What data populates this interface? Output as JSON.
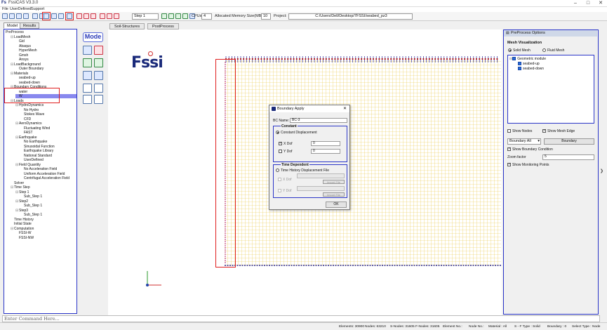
{
  "window": {
    "title": "FssiCAS V3.3.0"
  },
  "menu": [
    "File",
    "UserDefined",
    "Support"
  ],
  "toolbar": {
    "step_value": "Step 1",
    "cpus_label": "CPUs",
    "cpus_value": "4",
    "memory_label": "Allocated Memory Size(MB)",
    "memory_value": "10",
    "project_label": "Project:",
    "project_value": "C:/Users/Dell/Desktop/7FSSI/seabed_pz3"
  },
  "left_tabs": [
    "Model",
    "Results"
  ],
  "tree": [
    {
      "label": "PreProcess",
      "level": 0
    },
    {
      "label": "LoadMesh",
      "level": 1
    },
    {
      "label": "Gid",
      "level": 2
    },
    {
      "label": "Abaqus",
      "level": 2
    },
    {
      "label": "HyperMesh",
      "level": 2
    },
    {
      "label": "Gmsh",
      "level": 2
    },
    {
      "label": "Ansys",
      "level": 2
    },
    {
      "label": "LoadBackground",
      "level": 1
    },
    {
      "label": "Outer Boundary",
      "level": 2
    },
    {
      "label": "Materials",
      "level": 1
    },
    {
      "label": "seabed-up",
      "level": 2
    },
    {
      "label": "seabed-down",
      "level": 2
    },
    {
      "label": "Boundary Conditions",
      "level": 1
    },
    {
      "label": "water",
      "level": 2
    },
    {
      "label": "W",
      "level": 2
    },
    {
      "label": "Loads",
      "level": 1
    },
    {
      "label": "HydroDynamics",
      "level": 2
    },
    {
      "label": "No Hydro",
      "level": 3
    },
    {
      "label": "Stokes Wave",
      "level": 3
    },
    {
      "label": "CFD",
      "level": 3
    },
    {
      "label": "AeroDynamics",
      "level": 2
    },
    {
      "label": "Fluctuating Wind",
      "level": 3
    },
    {
      "label": "FAST",
      "level": 3
    },
    {
      "label": "Earthquake",
      "level": 2
    },
    {
      "label": "No Earthquake",
      "level": 3
    },
    {
      "label": "Sinusoidal Function",
      "level": 3
    },
    {
      "label": "Earthquake Library",
      "level": 3
    },
    {
      "label": "National Standard",
      "level": 3
    },
    {
      "label": "UserDefined",
      "level": 3
    },
    {
      "label": "Field Quantity",
      "level": 2
    },
    {
      "label": "No Acceleration Field",
      "level": 3
    },
    {
      "label": "Uniform Acceleration Field",
      "level": 3
    },
    {
      "label": "Centrifugal Acceleration Field",
      "level": 3
    },
    {
      "label": "Solver",
      "level": 1
    },
    {
      "label": "Time Step",
      "level": 1
    },
    {
      "label": "Step 1",
      "level": 2
    },
    {
      "label": "Sub_Step 1",
      "level": 3
    },
    {
      "label": "Step2",
      "level": 2
    },
    {
      "label": "Sub_Step 1",
      "level": 3
    },
    {
      "label": "Step3",
      "level": 2
    },
    {
      "label": "Sub_Step 1",
      "level": 3
    },
    {
      "label": "Time History",
      "level": 1
    },
    {
      "label": "Initial State",
      "level": 1
    },
    {
      "label": "Computation",
      "level": 1
    },
    {
      "label": "FSSI-W",
      "level": 2
    },
    {
      "label": "FSSI-NW",
      "level": 2
    }
  ],
  "center_tabs": [
    "Soil-Structures",
    "PostProcess"
  ],
  "logo_text": "Fssi",
  "dialog": {
    "title": "Boundary Apply",
    "bc_name_label": "BC Name:",
    "bc_name_value": "BC-3",
    "constant_group": "Constant",
    "constant_disp": "Constant Displacement",
    "x_dof": "X Dof",
    "x_dof_value": "0",
    "y_dof": "Y Dof",
    "y_dof_value": "0",
    "time_group": "Time Dependent",
    "time_history": "Time History Displacement File",
    "x_dof2": "X Dof",
    "y_dof2": "Y Dof",
    "import_file": "Import File",
    "ok": "OK"
  },
  "right_panel": {
    "header": "PreProcess Options",
    "mesh_vis": "Mesh Visualization",
    "solid_mesh": "Solid Mesh",
    "fluid_mesh": "Fluid Mesh",
    "geom_module": "Geometric module",
    "seabed_up": "seabed-up",
    "seabed_down": "seabed-down",
    "show_nodes": "Show Nodes",
    "show_mesh_edge": "Show Mesh Edge",
    "boundary_all": "Boundary All",
    "boundary_btn": "Boundary",
    "show_bc": "Show Boundary Condition",
    "zoom_label": "Zoom factor",
    "zoom_value": "5",
    "show_monitor": "Show Monitoring Points"
  },
  "command_placeholder": "Enter Command Here...",
  "status": {
    "elements": "Elements: 30900",
    "nodes": "Nodes: 63210",
    "s_nodes": "S-Nodes: 31605",
    "f_nodes": "F-Nodes: 31605",
    "element_no": "Element No.:",
    "node_no": "Node No.:",
    "material": "Material : All",
    "s_ftype": "S - F Type : Solid",
    "boundary": "Boundary : 0",
    "select_type": "Select Type : Node"
  }
}
